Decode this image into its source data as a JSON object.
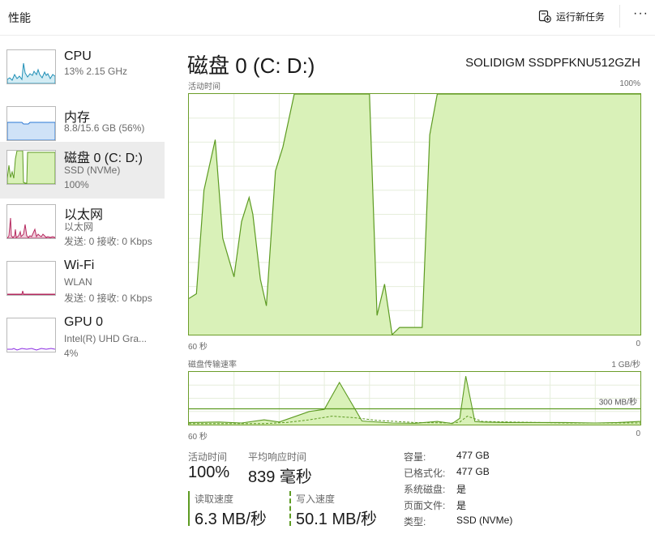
{
  "header": {
    "title": "性能",
    "run_task_label": "运行新任务",
    "more_label": "···"
  },
  "sidebar": {
    "items": [
      {
        "name": "CPU",
        "sub1": "13%  2.15 GHz",
        "sub2": "",
        "sub3": ""
      },
      {
        "name": "内存",
        "sub1": "8.8/15.6 GB (56%)",
        "sub2": "",
        "sub3": ""
      },
      {
        "name": "磁盘 0 (C: D:)",
        "sub1": "SSD (NVMe)",
        "sub2": "100%",
        "sub3": ""
      },
      {
        "name": "以太网",
        "sub1": "以太网",
        "sub2": "发送: 0 接收: 0 Kbps",
        "sub3": ""
      },
      {
        "name": "Wi-Fi",
        "sub1": "WLAN",
        "sub2": "发送: 0 接收: 0 Kbps",
        "sub3": ""
      },
      {
        "name": "GPU 0",
        "sub1": "Intel(R) UHD Gra...",
        "sub2": "4%",
        "sub3": ""
      }
    ],
    "colors": {
      "cpu": "#1f8fb6",
      "memory": "#2b78d4",
      "disk": "#5d9b22",
      "ethernet": "#b5285e",
      "gpu": "#8a2be2"
    }
  },
  "main": {
    "title": "磁盘 0 (C: D:)",
    "model": "SOLIDIGM SSDPFKNU512GZH",
    "activity_chart": {
      "label": "活动时间",
      "max_label": "100%",
      "x_left_label": "60 秒",
      "x_right_label": "0",
      "accent": "#5d9b22",
      "fill": "#d9f1b8"
    },
    "transfer_chart": {
      "label": "磁盘传输速率",
      "max_label": "1 GB/秒",
      "marker_label": "300 MB/秒",
      "x_left_label": "60 秒",
      "x_right_label": "0"
    },
    "stats": {
      "active_time_label": "活动时间",
      "active_time_value": "100%",
      "avg_response_label": "平均响应时间",
      "avg_response_value": "839 毫秒",
      "read_label": "读取速度",
      "read_value": "6.3 MB/秒",
      "write_label": "写入速度",
      "write_value": "50.1 MB/秒"
    },
    "props": [
      {
        "key": "容量:",
        "value": "477 GB"
      },
      {
        "key": "已格式化:",
        "value": "477 GB"
      },
      {
        "key": "系统磁盘:",
        "value": "是"
      },
      {
        "key": "页面文件:",
        "value": "是"
      },
      {
        "key": "类型:",
        "value": "SSD (NVMe)"
      }
    ]
  },
  "chart_data": [
    {
      "type": "area",
      "title": "活动时间",
      "ylabel": "",
      "ylim": [
        0,
        100
      ],
      "xlim": [
        60,
        0
      ],
      "x_unit": "秒",
      "grid": true,
      "series": [
        {
          "x": [
            60,
            59,
            58,
            56.5,
            55.5,
            54,
            53,
            52,
            51.5,
            50.5,
            49.7,
            48.5,
            47.5,
            46,
            45,
            44,
            43,
            42,
            41,
            40,
            39,
            38,
            37,
            36,
            35,
            34,
            33,
            32,
            31,
            30,
            29,
            28,
            27,
            26,
            25,
            24,
            23,
            22,
            21,
            20,
            19,
            18,
            17,
            16,
            15,
            14,
            13,
            12,
            11,
            10,
            9,
            8,
            7,
            6,
            5,
            4,
            3,
            2,
            1,
            0
          ],
          "values": [
            15,
            17,
            60,
            81,
            40,
            24,
            47,
            57,
            50,
            23,
            12,
            68,
            78,
            100,
            100,
            100,
            100,
            100,
            100,
            100,
            100,
            100,
            100,
            100,
            8,
            21,
            0,
            3,
            3,
            3,
            3,
            83,
            100,
            100,
            100,
            100,
            100,
            100,
            100,
            100,
            100,
            100,
            100,
            100,
            100,
            100,
            100,
            100,
            100,
            100,
            100,
            100,
            100,
            100,
            100,
            100,
            100,
            100,
            100,
            100
          ]
        }
      ]
    },
    {
      "type": "area",
      "title": "磁盘传输速率",
      "ylabel": "",
      "ylim": [
        0,
        1000
      ],
      "y_unit": "MB/秒",
      "xlim": [
        60,
        0
      ],
      "x_unit": "秒",
      "grid": true,
      "reference_line": 300,
      "series": [
        {
          "x": [
            60,
            56,
            53,
            50,
            48,
            46,
            44,
            42,
            40,
            37,
            33,
            30,
            27,
            25,
            24,
            23.2,
            22,
            21,
            18,
            14,
            10,
            6,
            3,
            0
          ],
          "values": [
            40,
            50,
            30,
            90,
            50,
            150,
            250,
            290,
            800,
            70,
            30,
            25,
            60,
            20,
            120,
            920,
            60,
            50,
            40,
            40,
            40,
            30,
            40,
            60
          ]
        },
        {
          "x": [
            60,
            50,
            47,
            44,
            41,
            38,
            35,
            30,
            25,
            24,
            23,
            21,
            10,
            0
          ],
          "values": [
            20,
            20,
            40,
            90,
            160,
            130,
            80,
            40,
            30,
            50,
            160,
            60,
            30,
            30
          ]
        }
      ]
    }
  ]
}
